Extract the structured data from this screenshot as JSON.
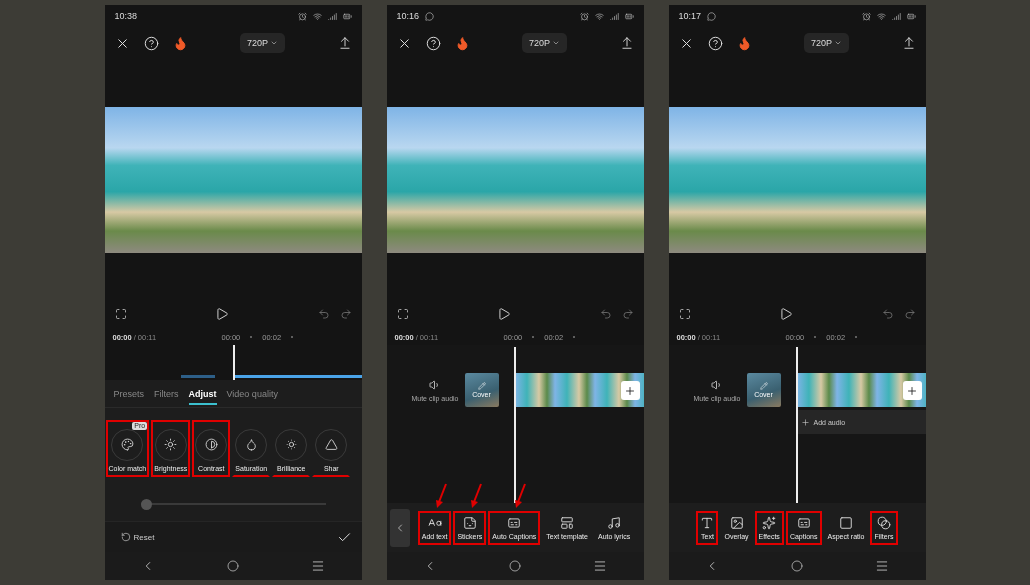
{
  "phones": [
    {
      "time": "10:38",
      "chat_icon": false,
      "quality": "720P",
      "current": "00:00",
      "total": "/ 00:11",
      "ruler": [
        "00:00",
        "00:02"
      ],
      "panel": {
        "kind": "adjust",
        "tabs": [
          {
            "label": "Presets",
            "selected": false
          },
          {
            "label": "Filters",
            "selected": false
          },
          {
            "label": "Adjust",
            "selected": true
          },
          {
            "label": "Video quality",
            "selected": false
          }
        ],
        "tools": [
          {
            "kind": "color-match",
            "label": "Color match",
            "badge": "Pro",
            "boxed": true,
            "underlined": false
          },
          {
            "kind": "brightness",
            "label": "Brightness",
            "boxed": true,
            "underlined": false
          },
          {
            "kind": "contrast",
            "label": "Contrast",
            "boxed": true,
            "underlined": false
          },
          {
            "kind": "saturation",
            "label": "Saturation",
            "boxed": false,
            "underlined": true
          },
          {
            "kind": "brilliance",
            "label": "Brilliance",
            "boxed": false,
            "underlined": true
          },
          {
            "kind": "sharpness",
            "label": "Shar",
            "boxed": false,
            "underlined": true
          }
        ],
        "slider": {
          "level": 0
        },
        "reset": "Reset"
      }
    },
    {
      "time": "10:16",
      "chat_icon": true,
      "quality": "720P",
      "current": "00:00",
      "total": "/ 00:11",
      "ruler": [
        "00:00",
        "00:02"
      ],
      "panel": {
        "kind": "timeline",
        "mute_label": "Mute clip audio",
        "cover": "Cover",
        "back_button": true,
        "tools": [
          {
            "kind": "add-text",
            "label": "Add text",
            "boxed": true,
            "arrow": true
          },
          {
            "kind": "stickers",
            "label": "Stickers",
            "boxed": true,
            "arrow": true
          },
          {
            "kind": "captions",
            "label": "Auto Captions",
            "boxed": true,
            "arrow": true
          },
          {
            "kind": "text-template",
            "label": "Text template",
            "boxed": false,
            "arrow": false
          },
          {
            "kind": "lyrics",
            "label": "Auto lyrics",
            "boxed": false,
            "arrow": false
          }
        ]
      }
    },
    {
      "time": "10:17",
      "chat_icon": true,
      "quality": "720P",
      "current": "00:00",
      "total": "/ 00:11",
      "ruler": [
        "00:00",
        "00:02"
      ],
      "panel": {
        "kind": "timeline",
        "mute_label": "Mute clip audio",
        "cover": "Cover",
        "add_audio": "Add audio",
        "back_button": false,
        "tools": [
          {
            "kind": "text",
            "label": "Text",
            "boxed": true,
            "arrow": false
          },
          {
            "kind": "overlay",
            "label": "Overlay",
            "boxed": false,
            "arrow": false
          },
          {
            "kind": "effects",
            "label": "Effects",
            "boxed": true,
            "arrow": false
          },
          {
            "kind": "captions-box",
            "label": "Captions",
            "boxed": true,
            "arrow": false
          },
          {
            "kind": "aspect",
            "label": "Aspect ratio",
            "boxed": false,
            "arrow": false
          },
          {
            "kind": "filters",
            "label": "Filters",
            "boxed": true,
            "arrow": false
          }
        ]
      }
    }
  ]
}
